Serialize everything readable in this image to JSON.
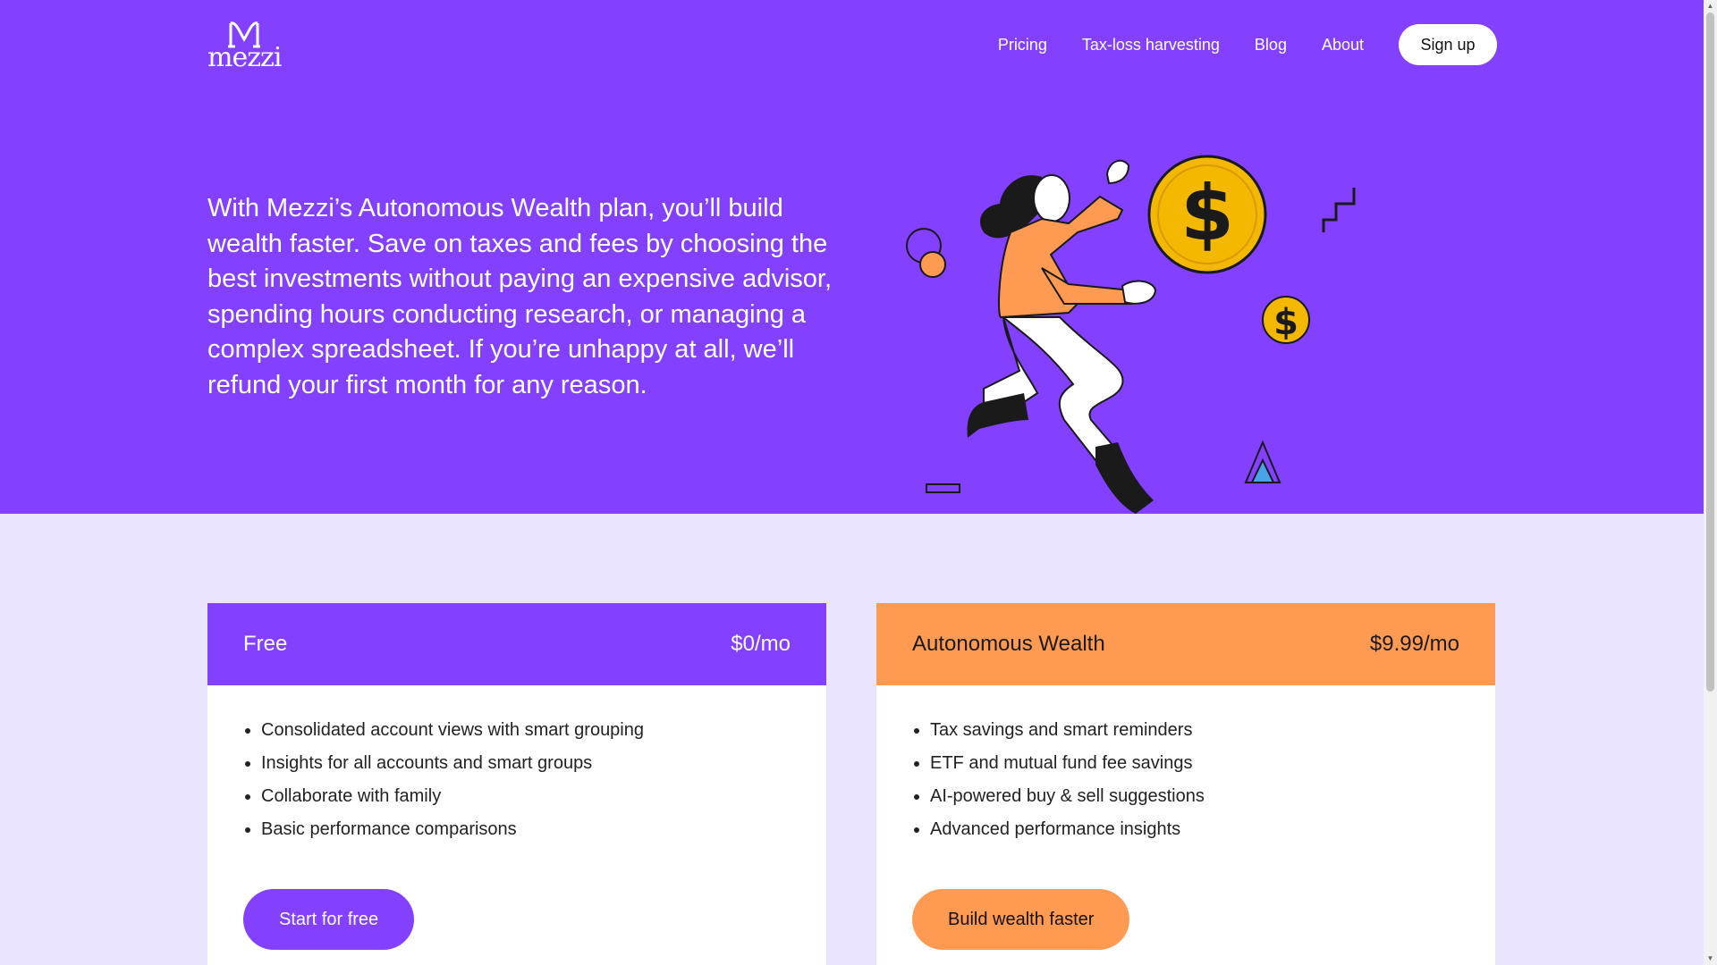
{
  "header": {
    "logo_text": "mezzi",
    "nav": [
      "Pricing",
      "Tax-loss harvesting",
      "Blog",
      "About"
    ],
    "signup_label": "Sign up"
  },
  "hero": {
    "text": "With Mezzi’s Autonomous Wealth plan, you’ll build wealth faster. Save on taxes and fees by choosing the best investments without paying an expensive advisor, spending hours conducting research, or managing a complex spreadsheet. If you’re unhappy at all, we’ll refund your first month for any reason.",
    "illustration": "woman-carrying-dollar-coin-illustration"
  },
  "plans": [
    {
      "name": "Free",
      "price": "$0/mo",
      "features": [
        "Consolidated account views with smart grouping",
        "Insights for all accounts and smart groups",
        "Collaborate with family",
        "Basic performance comparisons"
      ],
      "cta": "Start for free"
    },
    {
      "name": "Autonomous Wealth",
      "price": "$9.99/mo",
      "features": [
        "Tax savings and smart reminders",
        "ETF and mutual fund fee savings",
        "AI-powered buy & sell suggestions",
        "Advanced performance insights"
      ],
      "cta": "Build wealth faster"
    }
  ],
  "colors": {
    "purple": "#8340ff",
    "orange": "#ff9a52",
    "lavender": "#ebe4ff",
    "coin": "#f5b800"
  }
}
